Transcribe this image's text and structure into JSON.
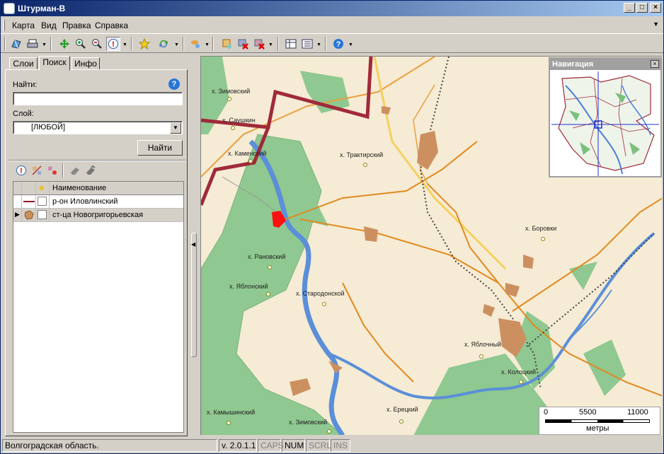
{
  "window": {
    "title": "Штурман-В",
    "minimize": "_",
    "maximize": "□",
    "close": "×"
  },
  "menu": {
    "items": [
      "Карта",
      "Вид",
      "Правка",
      "Справка"
    ]
  },
  "tabs": [
    "Слои",
    "Поиск",
    "Инфо"
  ],
  "search": {
    "find_label": "Найти:",
    "find_value": "",
    "layer_label": "Слой:",
    "layer_value": "[ЛЮБОЙ]",
    "find_button": "Найти",
    "help": "?"
  },
  "results": {
    "header": "Наименование",
    "rows": [
      {
        "name": "р-он Иловлинский",
        "selected": false
      },
      {
        "name": "ст-ца Новогригорьевская",
        "selected": true
      }
    ]
  },
  "map": {
    "towns": [
      "х. Зимовский",
      "х. Саушкин",
      "х. Каменский",
      "х. Трактирский",
      "х. Боровки",
      "х. Рановский",
      "х. Яблонский",
      "х. Стародонской",
      "х. Яблочный",
      "х. Колоцкий",
      "х. Камышинский",
      "х. Ерецкий",
      "х. Зимовский"
    ],
    "navigator_title": "Навигация",
    "navigator_close": "×",
    "scale": {
      "ticks": [
        "0",
        "5500",
        "11000"
      ],
      "unit": "метры"
    }
  },
  "status": {
    "region": "Волгоградская область.",
    "version": "v. 2.0.1.1",
    "caps": "CAPS",
    "num": "NUM",
    "scrl": "SCRL",
    "ins": "INS"
  }
}
